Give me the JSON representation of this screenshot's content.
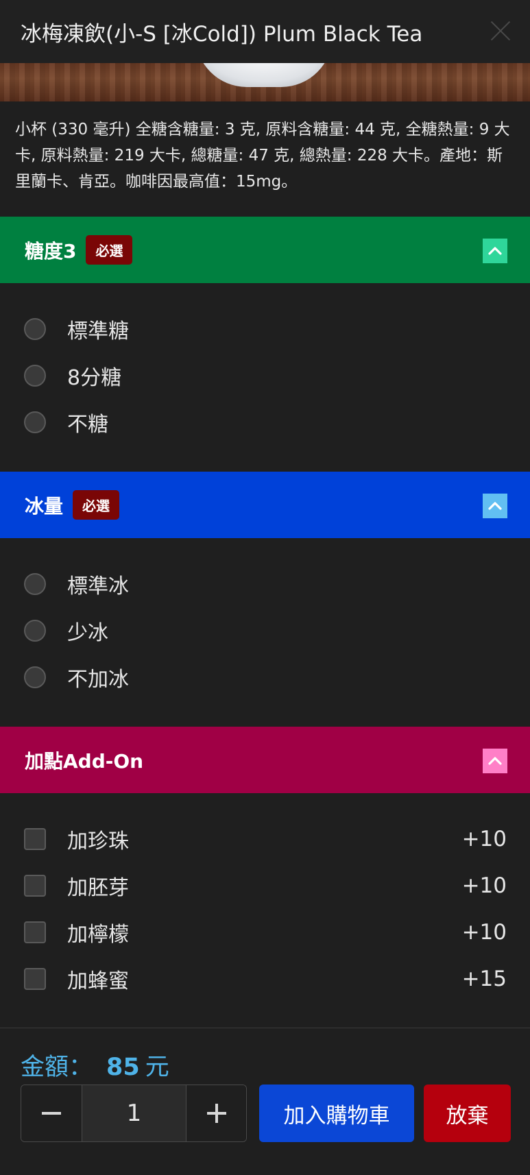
{
  "header": {
    "title": "冰梅凍飲(小-S [冰Cold]) Plum Black Tea",
    "close_icon": "close-icon"
  },
  "description": "小杯 (330 毫升) 全糖含糖量: 3 克, 原料含糖量: 44 克, 全糖熱量: 9 大卡, 原料熱量: 219 大卡, 總糖量: 47 克, 總熱量: 228 大卡。產地：斯里蘭卡、肯亞。咖啡因最高值：15mg。",
  "sections": {
    "sugar": {
      "title": "糖度3",
      "badge": "必選",
      "color": "#008040",
      "options": [
        "標準糖",
        "8分糖",
        "不糖"
      ]
    },
    "ice": {
      "title": "冰量",
      "badge": "必選",
      "color": "#0041d9",
      "options": [
        "標準冰",
        "少冰",
        "不加冰"
      ]
    },
    "addon": {
      "title": "加點Add-On",
      "color": "#a00045",
      "options": [
        {
          "label": "加珍珠",
          "price": "+10"
        },
        {
          "label": "加胚芽",
          "price": "+10"
        },
        {
          "label": "加檸檬",
          "price": "+10"
        },
        {
          "label": "加蜂蜜",
          "price": "+15"
        }
      ]
    }
  },
  "footer": {
    "total_label": "金額：",
    "total_amount": "85",
    "total_unit": "元",
    "quantity": "1",
    "add_to_cart": "加入購物車",
    "discard": "放棄"
  },
  "colors": {
    "background": "#1f1f1f",
    "total_text": "#4fb3e8",
    "required_badge": "#7a0606",
    "add_to_cart": "#0b47d6",
    "discard": "#b5000d"
  }
}
